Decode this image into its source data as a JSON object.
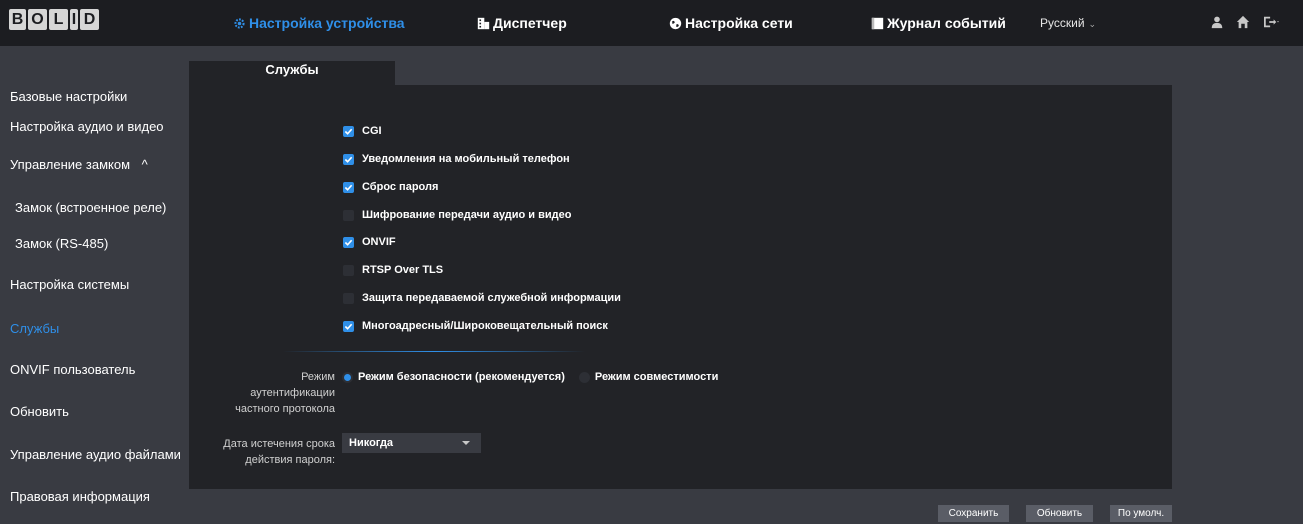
{
  "header": {
    "logo": [
      "B",
      "O",
      "L",
      "I",
      "D"
    ],
    "nav": [
      {
        "label": "Настройка устройства",
        "icon": "gear-icon",
        "active": true
      },
      {
        "label": "Диспетчер",
        "icon": "building-icon",
        "active": false
      },
      {
        "label": "Настройка сети",
        "icon": "globe-icon",
        "active": false
      },
      {
        "label": "Журнал событий",
        "icon": "log-icon",
        "active": false
      }
    ],
    "language": "Русский",
    "icons": [
      "user-icon",
      "home-icon",
      "logout-icon"
    ]
  },
  "sidebar": {
    "items": [
      {
        "label": "Базовые настройки"
      },
      {
        "label": "Настройка аудио и видео"
      },
      {
        "label": "Управление замком"
      },
      {
        "label": "Замок (встроенное реле)"
      },
      {
        "label": "Замок (RS-485)"
      },
      {
        "label": "Настройка системы"
      },
      {
        "label": "Службы"
      },
      {
        "label": "ONVIF пользователь"
      },
      {
        "label": "Обновить"
      },
      {
        "label": "Управление аудио файлами"
      },
      {
        "label": "Правовая информация"
      }
    ],
    "expand_glyph": "^"
  },
  "main": {
    "tab_label": "Службы",
    "checkboxes": [
      {
        "label": "CGI",
        "checked": true
      },
      {
        "label": "Уведомления на мобильный телефон",
        "checked": true
      },
      {
        "label": "Сброс пароля",
        "checked": true
      },
      {
        "label": "Шифрование передачи аудио и видео",
        "checked": false
      },
      {
        "label": "ONVIF",
        "checked": true
      },
      {
        "label": "RTSP Over TLS",
        "checked": false
      },
      {
        "label": "Защита передаваемой служебной информации",
        "checked": false
      },
      {
        "label": "Многоадресный/Широковещательный поиск",
        "checked": true
      }
    ],
    "auth_mode": {
      "label_lines": [
        "Режим",
        "аутентификации",
        "частного протокола"
      ],
      "options": [
        {
          "label": "Режим безопасности (рекомендуется)",
          "selected": true
        },
        {
          "label": "Режим совместимости",
          "selected": false
        }
      ]
    },
    "password_expiry": {
      "label_lines": [
        "Дата истечения срока",
        "действия пароля:"
      ],
      "value": "Никогда"
    }
  },
  "buttons": {
    "save": "Сохранить",
    "refresh": "Обновить",
    "default": "По умолч."
  },
  "colors": {
    "accent": "#2f8fe8",
    "background": "#393b42",
    "panel": "#222327",
    "topbar": "#1c1d21"
  }
}
